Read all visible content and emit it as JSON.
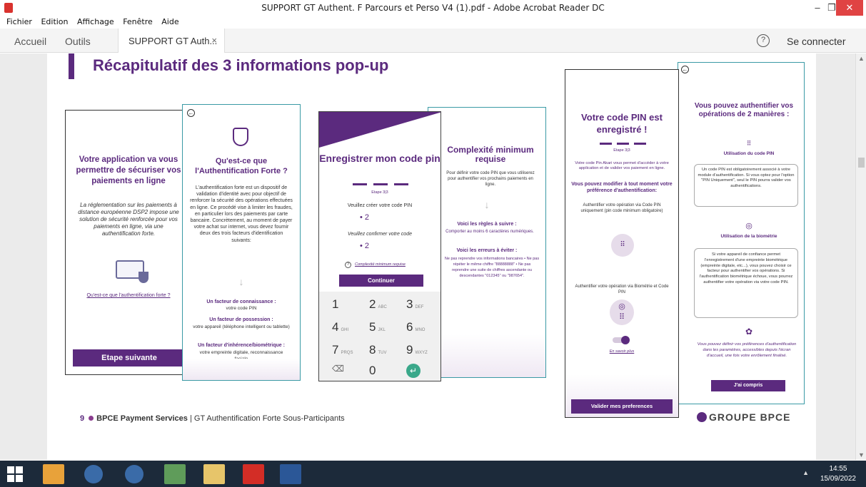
{
  "window": {
    "title": "SUPPORT GT Authent. F Parcours et Perso V4 (1).pdf - Adobe Acrobat Reader DC",
    "minimize": "–",
    "maximize": "❐",
    "close": "✕"
  },
  "menu": [
    "Fichier",
    "Edition",
    "Affichage",
    "Fenêtre",
    "Aide"
  ],
  "tabs": {
    "home": "Accueil",
    "tools": "Outils",
    "document": "SUPPORT GT Auth...",
    "close": "×",
    "help": "?",
    "signin": "Se connecter"
  },
  "slide": {
    "title": "Récapitulatif des 3 informations pop-up",
    "footer_num": "9",
    "footer_company": "BPCE Payment Services",
    "footer_sep": " | ",
    "footer_text": "GT Authentification Forte Sous-Participants",
    "logo": "GROUPE BPCE"
  },
  "card1": {
    "heading": "Votre application va vous permettre de sécuriser vos paiements en ligne",
    "body": "La réglementation sur les paiements à distance européenne DSP2 impose une solution de sécurité renforcée pour vos paiements en ligne, via une authentification forte.",
    "link": "Qu'est-ce que l'authentification forte ?",
    "button": "Etape suivante"
  },
  "card2": {
    "heading": "Qu'est-ce que l'Authentification Forte ?",
    "body": "L'authentification forte est un dispositif de validation d'identité avec pour objectif de renforcer la sécurité des opérations effectuées en ligne. Ce procédé vise à limiter les fraudes, en particulier lors des paiements par carte bancaire. Concrètement, au moment de payer votre achat sur internet, vous devez fournir deux des trois facteurs d'identification suivants:",
    "f1_title": "Un facteur de connaissance :",
    "f1_text": "votre code PIN",
    "f2_title": "Un facteur de possession :",
    "f2_text": "votre appareil (téléphone intelligent ou tablette)",
    "f3_title": "Un facteur d'inhérence/biométrique :",
    "f3_text": "votre empreinte digitale, reconnaissance faciale"
  },
  "card3": {
    "heading": "Enregistrer mon code pin",
    "step": "Etape 3|3",
    "create_label": "Veuillez créer votre code PIN",
    "create_value": "•   2",
    "confirm_label": "Veuillez confirmer votre code",
    "confirm_value": "•   2",
    "help_link": "Complexité minimum requise",
    "button": "Continuer",
    "keys": [
      {
        "d": "1",
        "l": ""
      },
      {
        "d": "2",
        "l": "ABC"
      },
      {
        "d": "3",
        "l": "DEF"
      },
      {
        "d": "4",
        "l": "GHI"
      },
      {
        "d": "5",
        "l": "JKL"
      },
      {
        "d": "6",
        "l": "MNO"
      },
      {
        "d": "7",
        "l": "PRQS"
      },
      {
        "d": "8",
        "l": "TUV"
      },
      {
        "d": "9",
        "l": "WXYZ"
      },
      {
        "d": "⌫",
        "l": ""
      },
      {
        "d": "0",
        "l": ""
      },
      {
        "d": "↵",
        "l": ""
      }
    ]
  },
  "card4": {
    "heading": "Complexité minimum requise",
    "intro": "Pour définir votre code PIN que vous utiliserez pour authentifier vos prochains paiements en ligne.",
    "rules_title": "Voici les règles à suivre :",
    "rules_text": "Comporter au moins 6 caractères numériques.",
    "errors_title": "Voici les erreurs à éviter :",
    "errors_text": "Ne pas reprendre vos informations bancaires • Ne pas répéter le même chiffre \"88888888\" • Ne pas reprendre une suite de chiffres ascendante ou descendantes \"012345\" ou \"987654\"."
  },
  "card5": {
    "heading": "Votre code PIN est enregistré !",
    "step": "Etape 3|3",
    "intro": "Votre code Pin Akari vous permet d'accéder à votre application et de valider vos paiement en ligne.",
    "change_title": "Vous pouvez modifier à tout moment votre préférence d'authentification:",
    "opt1": "Authentifier votre opération via Code PIN uniquement (pin code minimum obligatoire)",
    "opt2": "Authentifier votre opération via Biométrie et Code PIN",
    "link": "En savoir plus",
    "button": "Valider mes preferences"
  },
  "card6": {
    "heading": "Vous pouvez authentifier vos opérations de 2 manières :",
    "pin_title": "Utilisation du code PIN",
    "pin_text": "Un code PIN est obligatoirement associé à votre module d'authentification. Si vous optez pour l'option \"PIN Uniquement\", seul le PIN pourra valider vos authentifications.",
    "bio_title": "Utilisation de la biométrie",
    "bio_text": "Si votre appareil de confiance permet l'enregistrement d'une empreinte biométrique (empreinte digitale, etc...), vous pouvez choisir ce facteur pour authentifier vos opérations. Si l'authentification biométrique échoue, vous pourrez authentifier votre opération via votre code PIN.",
    "settings_text": "Vous pouvez définir vos préférences d'authentification dans les paramètres, accessibles depuis l'écran d'accueil, une fois votre enrôlement finalisé.",
    "button": "J'ai compris"
  },
  "taskbar": {
    "time": "14:55",
    "date": "15/09/2022",
    "tray": "▲"
  },
  "colors": {
    "brand_purple": "#5b2a7e",
    "teal_border": "#3a9aa5",
    "close_red": "#e04343",
    "taskbar": "#1c2a3a"
  }
}
